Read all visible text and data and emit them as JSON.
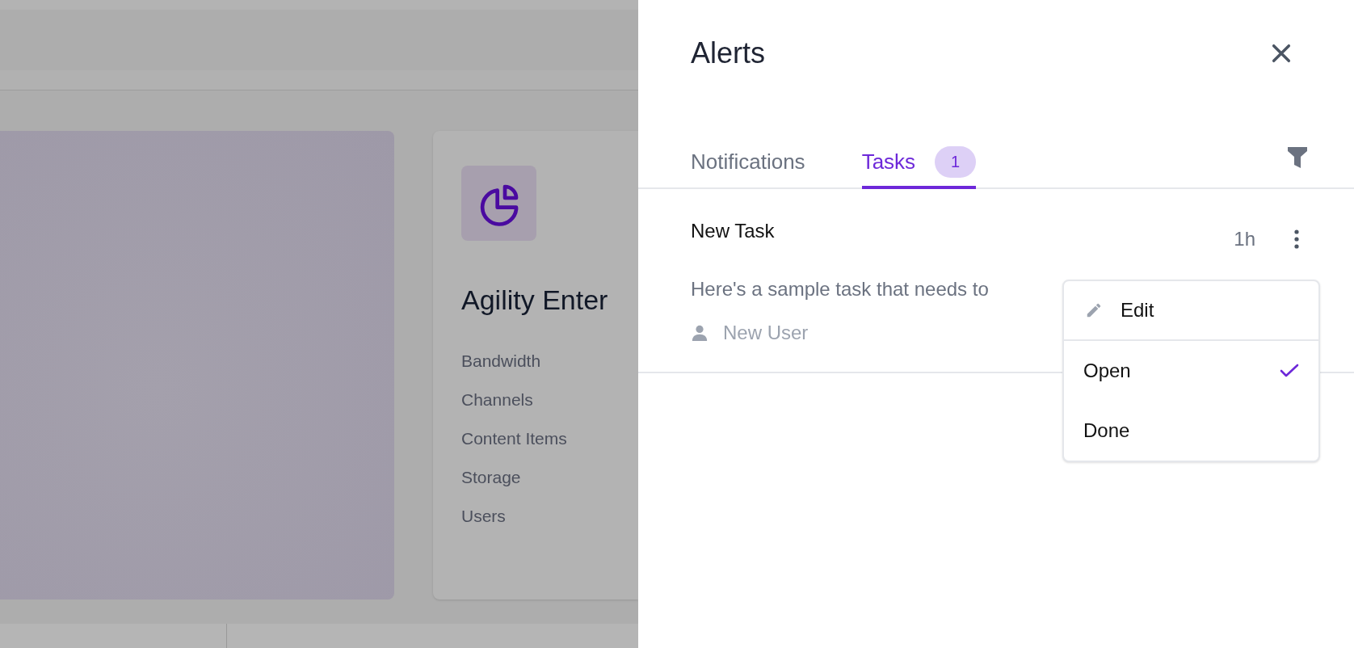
{
  "background": {
    "card_title": "Agility Enter",
    "card_items": [
      "Bandwidth",
      "Channels",
      "Content Items",
      "Storage",
      "Users"
    ]
  },
  "panel": {
    "title": "Alerts",
    "tabs": [
      {
        "label": "Notifications",
        "selected": false
      },
      {
        "label": "Tasks",
        "selected": true,
        "badge": "1"
      }
    ],
    "tasks": [
      {
        "title": "New Task",
        "time": "1h",
        "description": "Here's a sample task that needs to",
        "assignee": "New User"
      }
    ],
    "menu": [
      {
        "kind": "action",
        "label": "Edit"
      },
      {
        "kind": "status",
        "label": "Open",
        "checked": true
      },
      {
        "kind": "status",
        "label": "Done",
        "checked": false
      }
    ]
  }
}
